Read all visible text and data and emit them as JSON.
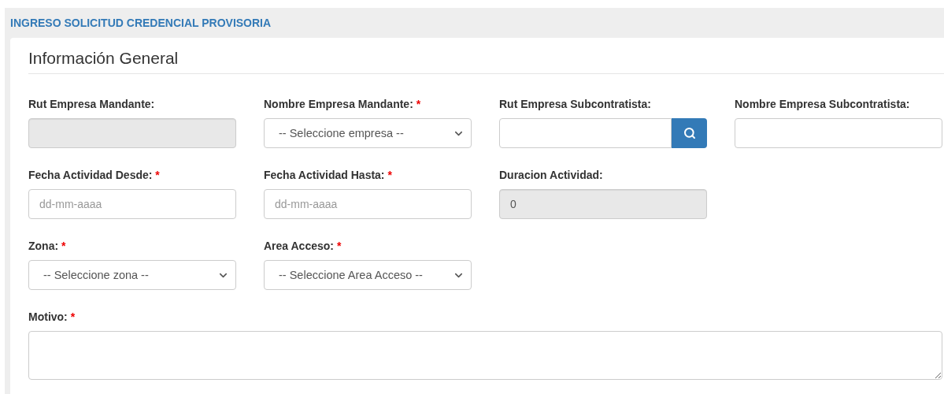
{
  "page_title": "INGRESO SOLICITUD CREDENCIAL PROVISORIA",
  "section_title": "Información General",
  "rows": [
    {
      "fields": [
        {
          "kind": "input",
          "label": "Rut Empresa Mandante:",
          "disabled": true
        },
        {
          "kind": "select",
          "label": "Nombre Empresa Mandante:",
          "required_mark": "*",
          "value": "-- Seleccione empresa --"
        },
        {
          "kind": "search",
          "label": "Rut Empresa Subcontratista:"
        },
        {
          "kind": "input",
          "label": "Nombre Empresa Subcontratista:",
          "disabled": false
        }
      ]
    },
    {
      "fields": [
        {
          "kind": "input",
          "label": "Fecha Actividad Desde:",
          "required_mark": "*",
          "placeholder": "dd-mm-aaaa",
          "disabled": false
        },
        {
          "kind": "input",
          "label": "Fecha Actividad Hasta:",
          "required_mark": "*",
          "placeholder": "dd-mm-aaaa",
          "disabled": false
        },
        {
          "kind": "input",
          "label": "Duracion Actividad:",
          "value": "0",
          "disabled": true
        }
      ]
    },
    {
      "fields": [
        {
          "kind": "select",
          "label": "Zona:",
          "required_mark": "*",
          "value": "-- Seleccione zona --"
        },
        {
          "kind": "select",
          "label": "Area Acceso:",
          "required_mark": "*",
          "value": "-- Seleccione Area Acceso --"
        }
      ]
    },
    {
      "fields": [
        {
          "kind": "textarea",
          "label": "Motivo:",
          "required_mark": "*"
        }
      ]
    }
  ]
}
